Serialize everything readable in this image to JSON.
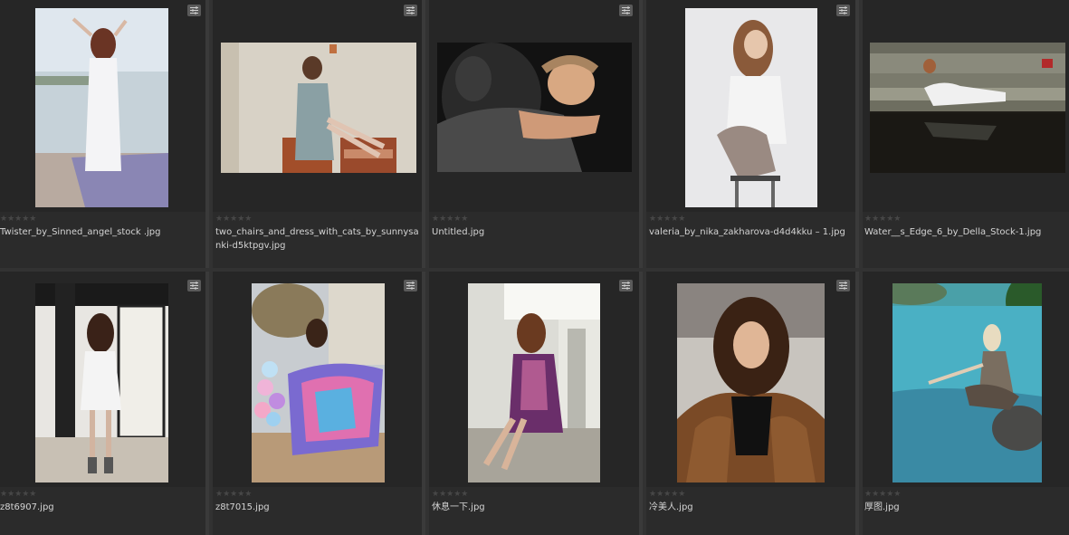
{
  "thumbnails": [
    {
      "filename": "Twister_by_Sinned_angel_stock .jpg",
      "rating_stars": "★★★★★",
      "settings_icon": "sliders-icon",
      "subject": "woman in white dress on pier"
    },
    {
      "filename": "two_chairs_and_dress_with_cats_by_sunnysanki-d5ktpgv.jpg",
      "rating_stars": "★★★★★",
      "settings_icon": "sliders-icon",
      "subject": "woman sitting on two chairs"
    },
    {
      "filename": "Untitled.jpg",
      "rating_stars": "★★★★★",
      "settings_icon": "sliders-icon",
      "subject": "woman reclining on black leather"
    },
    {
      "filename": "valeria_by_nika_zakharova-d4d4kku – 1.jpg",
      "rating_stars": "★★★★★",
      "settings_icon": "sliders-icon",
      "subject": "woman sitting on stool"
    },
    {
      "filename": "Water__s_Edge_6_by_Della_Stock-1.jpg",
      "rating_stars": "★★★★★",
      "settings_icon": "sliders-icon",
      "subject": "woman lying at water's edge"
    },
    {
      "filename": "z8t6907.jpg",
      "rating_stars": "★★★★★",
      "settings_icon": "sliders-icon",
      "subject": "woman in white dress by black pillar"
    },
    {
      "filename": "z8t7015.jpg",
      "rating_stars": "★★★★★",
      "settings_icon": "sliders-icon",
      "subject": "woman in colorful dress with balloons"
    },
    {
      "filename": "休息一下.jpg",
      "rating_stars": "★★★★★",
      "settings_icon": "sliders-icon",
      "subject": "woman sitting on chair by window"
    },
    {
      "filename": "冷美人.jpg",
      "rating_stars": "★★★★★",
      "settings_icon": "sliders-icon",
      "subject": "woman in fur coat"
    },
    {
      "filename": "厚图.jpg",
      "rating_stars": "★★★★★",
      "settings_icon": "sliders-icon",
      "subject": "woman sitting by turquoise water"
    }
  ],
  "colors": {
    "background": "#323232",
    "cell": "#2b2b2b",
    "thumb_area": "#262626",
    "text": "#d4d4d4",
    "stars": "#474747"
  }
}
